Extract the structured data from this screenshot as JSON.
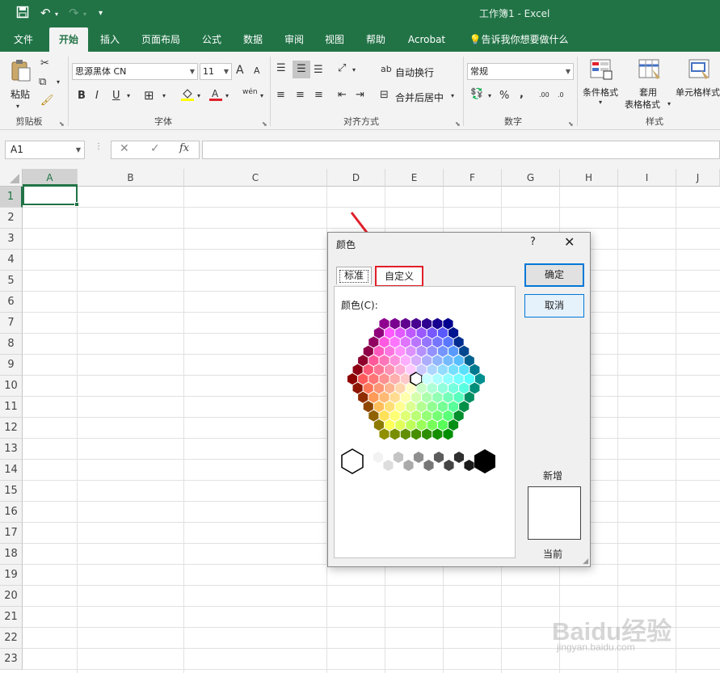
{
  "window": {
    "title": "工作簿1 - Excel"
  },
  "ribbon_tabs": [
    {
      "label": "文件"
    },
    {
      "label": "开始"
    },
    {
      "label": "插入"
    },
    {
      "label": "页面布局"
    },
    {
      "label": "公式"
    },
    {
      "label": "数据"
    },
    {
      "label": "审阅"
    },
    {
      "label": "视图"
    },
    {
      "label": "帮助"
    },
    {
      "label": "Acrobat"
    }
  ],
  "tell_me": "告诉我你想要做什么",
  "clipboard": {
    "paste": "粘贴",
    "group": "剪贴板"
  },
  "font": {
    "name": "思源黑体 CN",
    "size": "11",
    "group": "字体",
    "increase": "A",
    "decrease": "A",
    "bold": "B",
    "italic": "I",
    "underline": "U",
    "phonetic": "wén"
  },
  "alignment": {
    "wrap_text": "自动换行",
    "merge_center": "合并后居中",
    "group": "对齐方式"
  },
  "number": {
    "format": "常规",
    "percent": "%",
    "comma": ",",
    "inc_decimal": ".00",
    "dec_decimal": ".0",
    "group": "数字"
  },
  "styles": {
    "conditional": "条件格式",
    "table_format_1": "套用",
    "table_format_2": "表格格式",
    "cell_styles": "单元格样式",
    "group": "样式"
  },
  "formula_bar": {
    "name_box": "A1",
    "cancel": "✕",
    "enter": "✓",
    "fx": "fx",
    "value": ""
  },
  "columns": [
    "A",
    "B",
    "C",
    "D",
    "E",
    "F",
    "G",
    "H",
    "I",
    "J"
  ],
  "rows": [
    "1",
    "2",
    "3",
    "4",
    "5",
    "6",
    "7",
    "8",
    "9",
    "10",
    "11",
    "12",
    "13",
    "14",
    "15",
    "16",
    "17",
    "18",
    "19",
    "20",
    "21",
    "22",
    "23"
  ],
  "dialog": {
    "title": "颜色",
    "help": "?",
    "close": "✕",
    "tab_standard": "标准",
    "tab_custom": "自定义",
    "colors_label": "颜色(C):",
    "ok": "确定",
    "cancel": "取消",
    "new_label": "新增",
    "current_label": "当前"
  },
  "annotation_color": "#e0202a",
  "accent_color": "#217346",
  "watermark": {
    "main": "Baidu经验",
    "sub": "jingyan.baidu.com"
  }
}
